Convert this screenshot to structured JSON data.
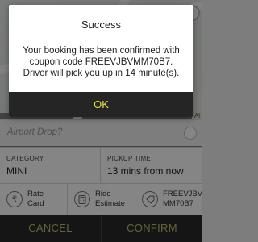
{
  "background": {
    "map_chip_text": "Al",
    "airport_drop": {
      "label": "Airport Drop?"
    },
    "info": {
      "category": {
        "title": "CATEGORY",
        "value": "MINI"
      },
      "pickup_time": {
        "title": "PICKUP TIME",
        "value": "13 mins from now"
      }
    },
    "actions": [
      {
        "label_line1": "Rate",
        "label_line2": "Card",
        "icon": "rupee-icon"
      },
      {
        "label_line1": "Ride",
        "label_line2": "Estimate",
        "icon": "calculator-icon"
      },
      {
        "label_line1": "FREEVJBV",
        "label_line2": "MM70B7",
        "icon": "coupon-icon"
      }
    ],
    "bottom_bar": {
      "cancel_label": "CANCEL",
      "confirm_label": "CONFIRM"
    }
  },
  "dialog": {
    "title": "Success",
    "message": "Your booking has been confirmed with coupon code FREEVJBVMM70B7. Driver will pick you up in 14 minute(s).",
    "ok_label": "OK"
  },
  "colors": {
    "ok_text": "#e2e23a",
    "bottom_text": "#bfbf6a",
    "dialog_button_bg": "#252525"
  }
}
